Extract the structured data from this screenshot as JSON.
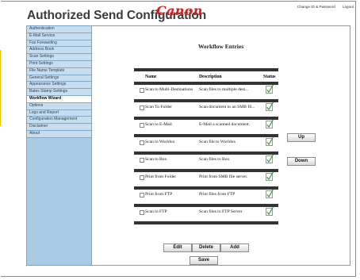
{
  "header": {
    "title": "Authorized Send Configuration",
    "logo_text": "Canon",
    "links": [
      "Change ID & Password",
      "Logout"
    ]
  },
  "sidebar": {
    "items": [
      "Authentication",
      "E-Mail Service",
      "Fax Forwarding",
      "Address Book",
      "Scan Settings",
      "Print Settings",
      "File Name Template",
      "General Settings",
      "Appearance Settings",
      "Bates Stamp Settings",
      "Workflow Wizard",
      "Options",
      "Logs and Report",
      "Configuration Management",
      "Disclaimer",
      "About"
    ],
    "active_index": 10
  },
  "main": {
    "section_title": "Workflow Entries",
    "columns": {
      "name": "Name",
      "description": "Status"
    },
    "col_name": "Name",
    "col_description": "Description",
    "col_status": "Status",
    "rows": [
      {
        "name": "Scan to Multi-Destinations",
        "description": "Scan files to multiple dest..."
      },
      {
        "name": "Scan To Folder",
        "description": "Scan document to an SMB fil..."
      },
      {
        "name": "Scan to E-Mail",
        "description": "E-Mail a scanned document."
      },
      {
        "name": "Scan to Worldox",
        "description": "Scan file to Worldox"
      },
      {
        "name": "Scan to Box",
        "description": "Scan files to Box"
      },
      {
        "name": "Print from Folder",
        "description": "Print from SMB file server."
      },
      {
        "name": "Print from FTP",
        "description": "Print files from FTP"
      },
      {
        "name": "Scan to FTP",
        "description": "Scan files to FTP Server"
      }
    ],
    "buttons": {
      "up": "Up",
      "down": "Down",
      "edit": "Edit",
      "delete": "Delete",
      "add": "Add",
      "save": "Save"
    }
  },
  "colors": {
    "sidebar_bg": "#a9cbe6",
    "logo": "#d31f1f",
    "status_check": "#2e9a2e",
    "accent": "#f2c20b"
  }
}
